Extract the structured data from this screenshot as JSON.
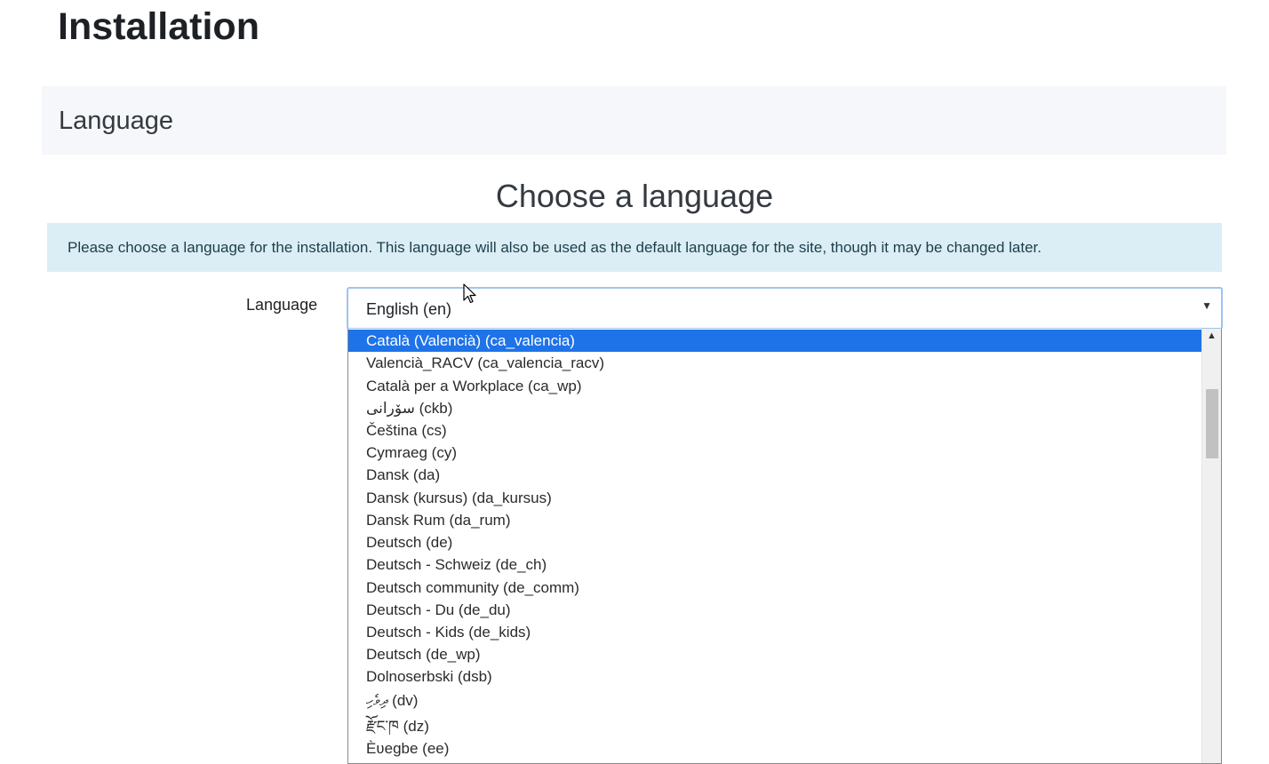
{
  "page": {
    "heading": "Installation"
  },
  "section": {
    "title": "Language"
  },
  "choose": {
    "title": "Choose a language"
  },
  "info": {
    "text": "Please choose a language for the installation. This language will also be used as the default language for the site, though it may be changed later."
  },
  "form": {
    "label": "Language",
    "selected_value": "English (en)"
  },
  "dropdown": {
    "options": [
      {
        "label": "Català (Valencià) (ca_valencia)",
        "selected": true
      },
      {
        "label": "Valencià_RACV (ca_valencia_racv)"
      },
      {
        "label": "Català per a Workplace (ca_wp)"
      },
      {
        "label": "سۆرانی (ckb)"
      },
      {
        "label": "Čeština (cs)"
      },
      {
        "label": "Cymraeg (cy)"
      },
      {
        "label": "Dansk (da)"
      },
      {
        "label": "Dansk (kursus) (da_kursus)"
      },
      {
        "label": "Dansk Rum (da_rum)"
      },
      {
        "label": "Deutsch (de)"
      },
      {
        "label": "Deutsch - Schweiz (de_ch)"
      },
      {
        "label": "Deutsch community (de_comm)"
      },
      {
        "label": "Deutsch - Du (de_du)"
      },
      {
        "label": "Deutsch - Kids (de_kids)"
      },
      {
        "label": "Deutsch (de_wp)"
      },
      {
        "label": "Dolnoserbski (dsb)"
      },
      {
        "label": "ދިވެހި (dv)"
      },
      {
        "label": "རྫོང་ཁ (dz)"
      },
      {
        "label": "Èʋegbe (ee)"
      }
    ]
  },
  "colors": {
    "selected_option_bg": "#1e73e8",
    "info_bg": "#dbeef5",
    "section_bg": "#f5f7fa"
  }
}
